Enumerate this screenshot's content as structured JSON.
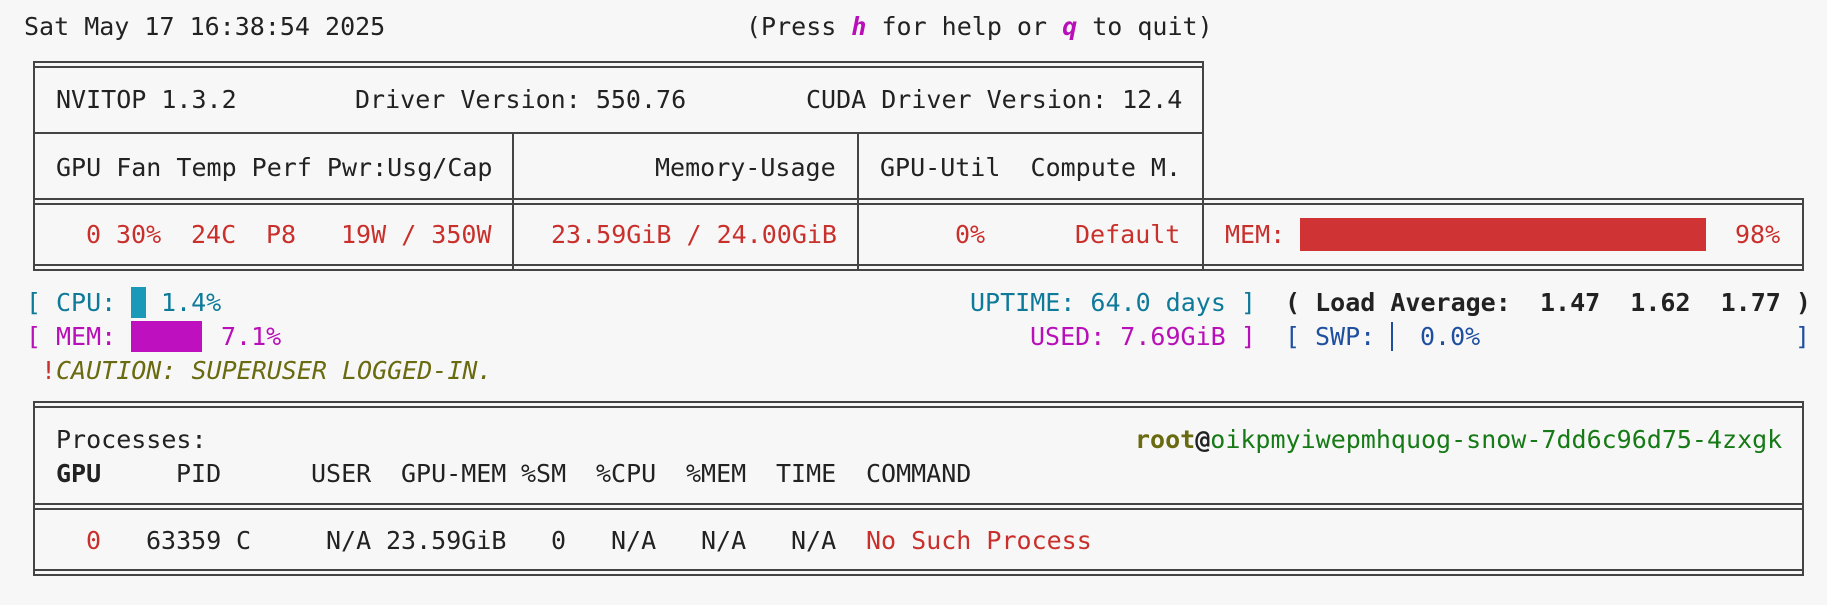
{
  "header": {
    "datetime": "Sat May 17 16:38:54 2025",
    "help_prefix": "(Press ",
    "help_key": "h",
    "help_middle": " for help or ",
    "quit_key": "q",
    "help_suffix": " to quit)"
  },
  "gpu_header": {
    "app_version": "NVITOP 1.3.2",
    "driver_version": "Driver Version: 550.76",
    "cuda_version": "CUDA Driver Version: 12.4",
    "col_left": "GPU Fan Temp Perf Pwr:Usg/Cap",
    "col_mid": "Memory-Usage",
    "col_right": "GPU-Util  Compute M."
  },
  "gpu_row": {
    "index": "0",
    "fan": "30%",
    "temp": "24C",
    "perf": "P8",
    "power": "19W / 350W",
    "memory": "23.59GiB / 24.00GiB",
    "util": "0%",
    "compute_mode": "Default",
    "mem_label": "MEM:",
    "mem_percent": "98%",
    "mem_fraction": 0.98
  },
  "host": {
    "cpu_open": "[",
    "cpu_label": "CPU:",
    "cpu_percent": "1.4%",
    "cpu_fraction": 0.014,
    "uptime": "UPTIME: 64.0 days ]",
    "load_label": "( Load Average:",
    "load_values": "1.47  1.62  1.77 )",
    "mem_open": "[",
    "mem_label": "MEM:",
    "mem_percent": "7.1%",
    "mem_fraction": 0.071,
    "used": "USED: 7.69GiB ]",
    "swp_open": "[",
    "swp_label": "SWP:",
    "swp_percent": "0.0%",
    "swp_close": "]",
    "caution_mark": "!",
    "caution": "CAUTION: SUPERUSER LOGGED-IN."
  },
  "processes": {
    "title": "Processes:",
    "user": "root",
    "at": "@",
    "hostname": "oikpmyiwepmhquog-snow-7dd6c96d75-4zxgk",
    "columns": {
      "gpu": "GPU",
      "pid": "PID",
      "user": "USER",
      "gpu_mem": "GPU-MEM",
      "sm": "%SM",
      "cpu": "%CPU",
      "mem": "%MEM",
      "time": "TIME",
      "command": "COMMAND"
    },
    "rows": [
      {
        "gpu": "0",
        "pid": "63359",
        "type": "C",
        "user": "N/A",
        "gpu_mem": "23.59GiB",
        "sm": "0",
        "cpu": "N/A",
        "mem": "N/A",
        "time": "N/A",
        "command": "No Such Process"
      }
    ]
  },
  "colors": {
    "gpu_row": "#c9302c",
    "cpu": "#0e7a9a",
    "cpu_bar": "#1a9ab8",
    "mem": "#b80fb8",
    "mem_bar": "#bf10bf",
    "swp": "#1f4f9f",
    "caution": "#6a6a10",
    "hostname": "#167a16",
    "gpu_mem_bar": "#cf3333"
  }
}
